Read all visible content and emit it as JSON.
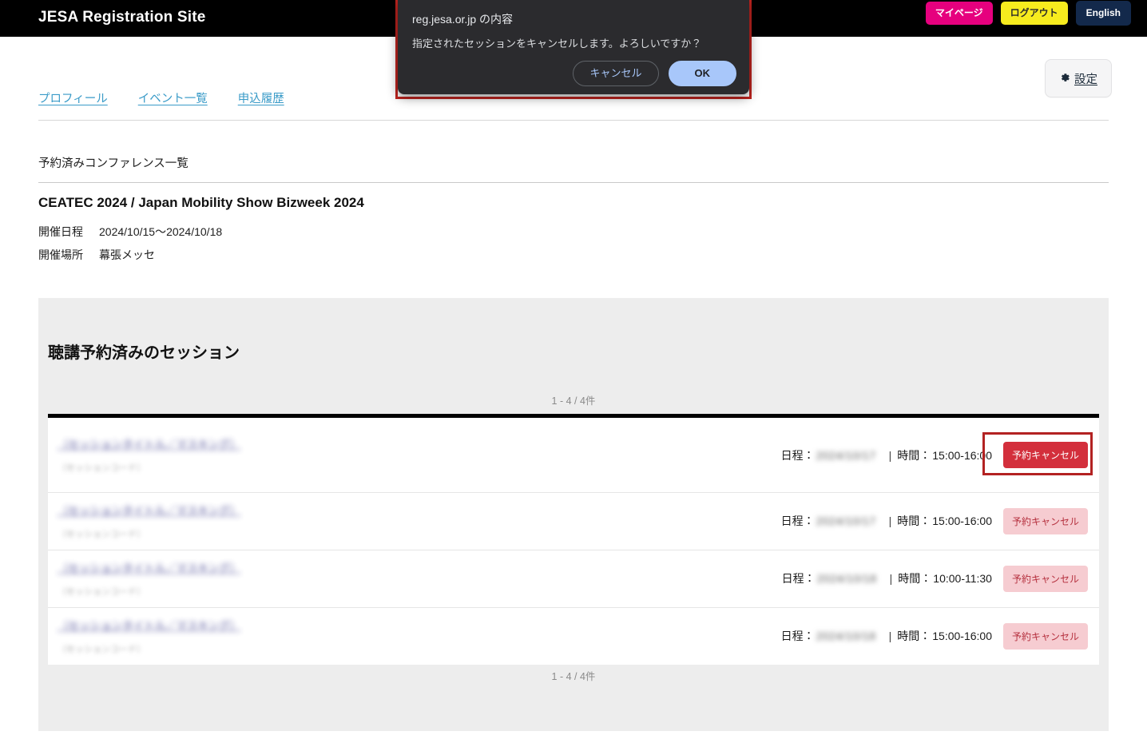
{
  "header": {
    "brand": "JESA Registration Site",
    "buttons": [
      {
        "id": "mypage",
        "label": "マイページ"
      },
      {
        "id": "logout",
        "label": "ログアウト"
      },
      {
        "id": "english",
        "label": "English"
      }
    ],
    "colors": {
      "bar_bg": "#000000",
      "mypage_bg": "#e6007e",
      "logout_bg": "#f7ec1e",
      "english_bg": "#13294b"
    }
  },
  "nav": {
    "links": [
      {
        "id": "profile",
        "label": "プロフィール"
      },
      {
        "id": "event-list",
        "label": "イベント一覧"
      },
      {
        "id": "application-history",
        "label": "申込履歴"
      }
    ],
    "link_color": "#3a9bc8"
  },
  "settings": {
    "icon": "gear-icon",
    "glyph": "✿",
    "label": "設定"
  },
  "section": {
    "heading": "予約済みコンファレンス一覧",
    "conference_title": "CEATEC 2024 / Japan Mobility Show Bizweek 2024",
    "meta": [
      {
        "key": "開催日程",
        "value": "2024/10/15〜2024/10/18"
      },
      {
        "key": "開催場所",
        "value": "幕張メッセ"
      }
    ]
  },
  "sessions_panel": {
    "title": "聴講予約済みのセッション",
    "pager_top": "1 - 4 / 4件",
    "pager_bottom": "1 - 4 / 4件",
    "labels": {
      "date_prefix": "日程：",
      "time_prefix": "時間：",
      "separator": "|",
      "cancel_button": "予約キャンセル"
    },
    "rows": [
      {
        "title": "（セッションタイトル／マスキング）",
        "subtitle": "（セッションコード）",
        "date": "2024/10/17",
        "time": "15:00-16:00",
        "cancel_label": "予約キャンセル",
        "active": true,
        "two_line": true
      },
      {
        "title": "（セッションタイトル／マスキング）",
        "subtitle": "（セッションコード）",
        "date": "2024/10/17",
        "time": "15:00-16:00",
        "cancel_label": "予約キャンセル",
        "active": false,
        "two_line": false
      },
      {
        "title": "（セッションタイトル／マスキング）",
        "subtitle": "（セッションコード）",
        "date": "2024/10/18",
        "time": "10:00-11:30",
        "cancel_label": "予約キャンセル",
        "active": false,
        "two_line": false
      },
      {
        "title": "（セッションタイトル／マスキング）",
        "subtitle": "（セッションコード）",
        "date": "2024/10/18",
        "time": "15:00-16:00",
        "cancel_label": "予約キャンセル",
        "active": false,
        "two_line": false
      }
    ]
  },
  "dialog": {
    "origin": "reg.jesa.or.jp の内容",
    "message": "指定されたセッションをキャンセルします。よろしいですか？",
    "cancel_label": "キャンセル",
    "ok_label": "OK",
    "accent": "#a8c7fa",
    "outline_color": "#c0241f"
  }
}
